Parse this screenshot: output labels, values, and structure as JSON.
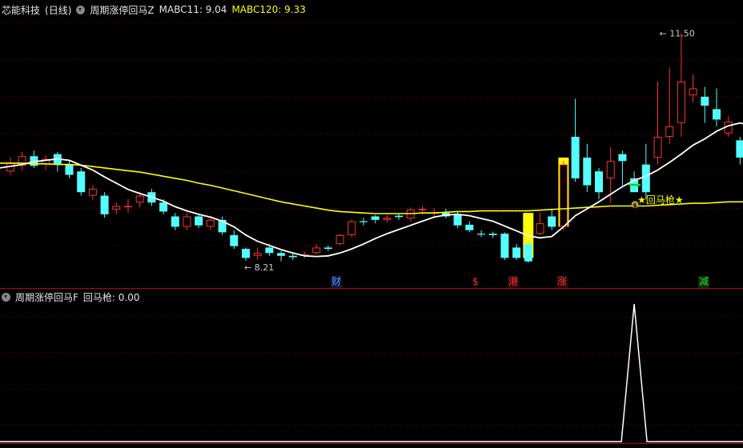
{
  "header": {
    "stock_name": "芯能科技",
    "period": "(日线)",
    "indicator": "周期涨停回马Z",
    "ma_short_label": "MABC11",
    "ma_short_value": "9.04",
    "ma_long_label": "MABC120",
    "ma_long_value": "9.33"
  },
  "sub_header": {
    "indicator": "周期涨停回马F",
    "signal_label": "回马枪",
    "signal_value": "0.00"
  },
  "colors": {
    "up": "#ff3232",
    "down": "#54ffff",
    "ma_short": "#ffffff",
    "ma_long": "#ffff00",
    "limit_bar": "#ffff00",
    "grid": "#800000",
    "divider": "#c00000",
    "signal_line": "#ffffff"
  },
  "annotations": {
    "high_label": "11.50",
    "low_label": "8.21",
    "signal_text": "回马枪",
    "star": "★",
    "coin": "$"
  },
  "event_tags": [
    {
      "text": "财",
      "color": "#5a8cff",
      "bg": "#0a1a3a"
    },
    {
      "text": "$",
      "color": "#ff3030",
      "bg": "#000000"
    },
    {
      "text": "港",
      "color": "#ff3030",
      "bg": "#2a0a0a"
    },
    {
      "text": "涨",
      "color": "#ff3030",
      "bg": "#2a0a0a"
    },
    {
      "text": "减",
      "color": "#33dd33",
      "bg": "#0a2a0a"
    }
  ],
  "chart_data": {
    "type": "candlestick",
    "ylim": [
      8.0,
      11.7
    ],
    "candles": [
      [
        9.5,
        9.62,
        9.7,
        9.45
      ],
      [
        9.58,
        9.72,
        9.78,
        9.52
      ],
      [
        9.72,
        9.58,
        9.8,
        9.55
      ],
      [
        9.6,
        9.68,
        9.74,
        9.52
      ],
      [
        9.75,
        9.6,
        9.78,
        9.5
      ],
      [
        9.6,
        9.45,
        9.65,
        9.4
      ],
      [
        9.5,
        9.2,
        9.55,
        9.15
      ],
      [
        9.15,
        9.25,
        9.3,
        9.08
      ],
      [
        9.15,
        8.88,
        9.2,
        8.83
      ],
      [
        8.95,
        9.0,
        9.05,
        8.88
      ],
      [
        9.0,
        9.0,
        9.1,
        8.9
      ],
      [
        9.05,
        9.15,
        9.2,
        8.98
      ],
      [
        9.2,
        9.05,
        9.25,
        9.0
      ],
      [
        9.05,
        8.92,
        9.1,
        8.88
      ],
      [
        8.85,
        8.7,
        8.9,
        8.65
      ],
      [
        8.7,
        8.85,
        8.9,
        8.65
      ],
      [
        8.85,
        8.72,
        8.88,
        8.68
      ],
      [
        8.7,
        8.8,
        8.85,
        8.65
      ],
      [
        8.8,
        8.62,
        8.85,
        8.58
      ],
      [
        8.58,
        8.42,
        8.65,
        8.38
      ],
      [
        8.38,
        8.25,
        8.4,
        8.21
      ],
      [
        8.28,
        8.32,
        8.4,
        8.22
      ],
      [
        8.4,
        8.32,
        8.45,
        8.28
      ],
      [
        8.32,
        8.28,
        8.35,
        8.2
      ],
      [
        8.28,
        8.26,
        8.33,
        8.22
      ],
      [
        8.28,
        8.3,
        8.34,
        8.25
      ],
      [
        8.32,
        8.4,
        8.45,
        8.3
      ],
      [
        8.4,
        8.38,
        8.43,
        8.35
      ],
      [
        8.45,
        8.58,
        8.6,
        8.43
      ],
      [
        8.58,
        8.78,
        8.8,
        8.55
      ],
      [
        8.78,
        8.77,
        8.83,
        8.72
      ],
      [
        8.85,
        8.8,
        8.87,
        8.75
      ],
      [
        8.8,
        8.83,
        8.87,
        8.76
      ],
      [
        8.86,
        8.84,
        8.89,
        8.8
      ],
      [
        8.82,
        8.95,
        8.98,
        8.78
      ],
      [
        8.94,
        8.96,
        9.0,
        8.88
      ],
      [
        8.9,
        8.91,
        8.97,
        8.85
      ],
      [
        8.9,
        8.85,
        8.96,
        8.82
      ],
      [
        8.88,
        8.72,
        8.92,
        8.68
      ],
      [
        8.73,
        8.65,
        8.78,
        8.62
      ],
      [
        8.6,
        8.59,
        8.65,
        8.55
      ],
      [
        8.6,
        8.58,
        8.63,
        8.54
      ],
      [
        8.6,
        8.25,
        8.62,
        8.22
      ],
      [
        8.4,
        8.25,
        8.45,
        8.22
      ],
      [
        8.45,
        8.2,
        8.5,
        8.18
      ],
      [
        8.6,
        8.75,
        8.9,
        8.58
      ],
      [
        8.85,
        8.7,
        8.95,
        8.65
      ],
      [
        8.7,
        9.6,
        9.65,
        8.65
      ],
      [
        10.0,
        9.4,
        10.55,
        9.35
      ],
      [
        9.7,
        9.3,
        9.9,
        9.2
      ],
      [
        9.5,
        9.2,
        9.55,
        9.1
      ],
      [
        9.4,
        9.65,
        9.85,
        9.05
      ],
      [
        9.75,
        9.65,
        9.8,
        9.3
      ],
      [
        9.4,
        9.2,
        9.5,
        9.2
      ],
      [
        9.6,
        9.2,
        9.9,
        9.1
      ],
      [
        9.7,
        10.0,
        10.8,
        9.6
      ],
      [
        10.0,
        10.15,
        11.0,
        9.9
      ],
      [
        10.2,
        10.8,
        11.5,
        10.0
      ],
      [
        10.6,
        10.7,
        10.9,
        10.5
      ],
      [
        10.58,
        10.45,
        10.72,
        10.2
      ],
      [
        10.4,
        10.25,
        10.7,
        10.15
      ],
      [
        10.05,
        10.22,
        10.3,
        10.0
      ],
      [
        9.95,
        9.7,
        10.0,
        9.6
      ],
      [
        9.7,
        9.75,
        9.85,
        9.65
      ],
      [
        9.7,
        9.5,
        9.8,
        9.4
      ]
    ],
    "ma_short": [
      9.55,
      9.6,
      9.64,
      9.66,
      9.68,
      9.66,
      9.59,
      9.52,
      9.42,
      9.33,
      9.24,
      9.18,
      9.13,
      9.07,
      8.99,
      8.93,
      8.88,
      8.84,
      8.78,
      8.7,
      8.58,
      8.49,
      8.43,
      8.37,
      8.32,
      8.28,
      8.27,
      8.28,
      8.32,
      8.38,
      8.45,
      8.53,
      8.6,
      8.66,
      8.72,
      8.78,
      8.84,
      8.87,
      8.88,
      8.86,
      8.82,
      8.78,
      8.71,
      8.64,
      8.57,
      8.54,
      8.56,
      8.7,
      8.86,
      8.96,
      9.06,
      9.17,
      9.28,
      9.37,
      9.43,
      9.52,
      9.63,
      9.75,
      9.88,
      9.97,
      10.08,
      10.16,
      10.2,
      10.15,
      10.05
    ],
    "ma_long": [
      9.62,
      9.62,
      9.61,
      9.61,
      9.6,
      9.6,
      9.59,
      9.57,
      9.55,
      9.53,
      9.51,
      9.49,
      9.46,
      9.43,
      9.4,
      9.37,
      9.33,
      9.3,
      9.26,
      9.22,
      9.18,
      9.14,
      9.1,
      9.06,
      9.03,
      9.0,
      8.97,
      8.94,
      8.92,
      8.91,
      8.9,
      8.89,
      8.89,
      8.89,
      8.89,
      8.9,
      8.9,
      8.91,
      8.92,
      8.92,
      8.93,
      8.93,
      8.93,
      8.93,
      8.93,
      8.94,
      8.95,
      8.96,
      8.97,
      8.98,
      8.99,
      9.0,
      9.0,
      9.0,
      9.0,
      9.01,
      9.02,
      9.03,
      9.04,
      9.04,
      9.05,
      9.06,
      9.06,
      9.06,
      9.06
    ],
    "limit_up_bars": [
      {
        "index": 44,
        "open": 8.25,
        "close": 8.9
      },
      {
        "index": 47,
        "open": 8.7,
        "close": 9.7
      }
    ],
    "high_marker": {
      "index": 55,
      "value": 11.5
    },
    "low_marker": {
      "index": 20,
      "value": 8.21
    },
    "signal": {
      "index": 53,
      "value": 9.02
    },
    "sub_signal": {
      "index": 53,
      "value": 1.0,
      "ylim": [
        0,
        1.0
      ]
    }
  }
}
